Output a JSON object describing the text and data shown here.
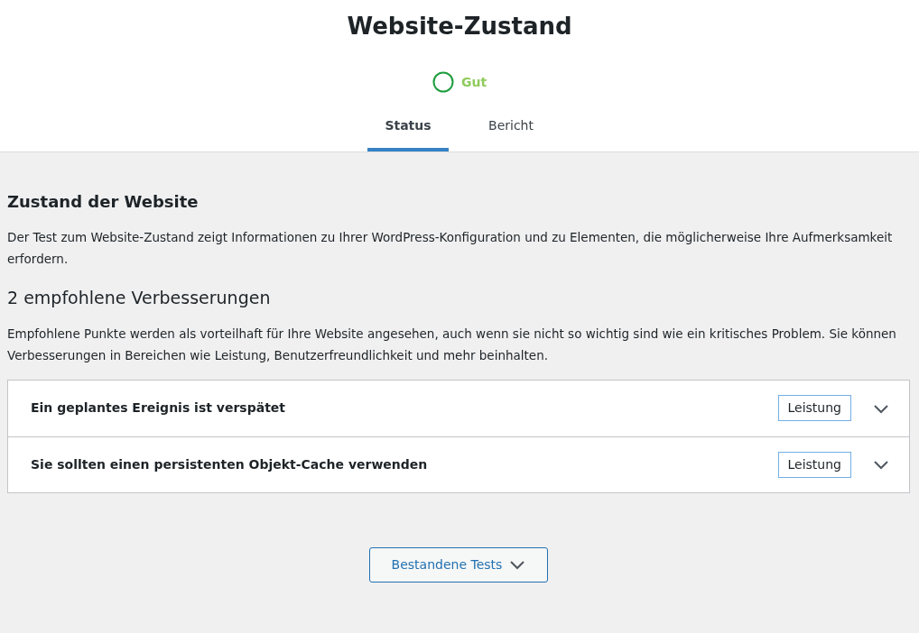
{
  "title": "Website-Zustand",
  "status": {
    "label": "Gut"
  },
  "tabs": [
    {
      "label": "Status",
      "selected": true
    },
    {
      "label": "Bericht",
      "selected": false
    }
  ],
  "section": {
    "heading": "Zustand der Website",
    "description": "Der Test zum Website-Zustand zeigt Informationen zu Ihrer WordPress-Konfiguration und zu Elementen, die möglicherweise Ihre Aufmerksamkeit erfordern."
  },
  "recommended": {
    "heading": "2 empfohlene Verbesserungen",
    "description": "Empfohlene Punkte werden als vorteilhaft für Ihre Website angesehen, auch wenn sie nicht so wichtig sind wie ein kritisches Problem. Sie können Verbesserungen in Bereichen wie Leistung, Benutzerfreundlichkeit und mehr beinhalten.",
    "items": [
      {
        "title": "Ein geplantes Ereignis ist verspätet",
        "tag": "Leistung",
        "expanded": false
      },
      {
        "title": "Sie sollten einen persistenten Objekt-Cache verwenden",
        "tag": "Leistung",
        "expanded": false
      }
    ]
  },
  "passed_button": {
    "label": "Bestandene Tests",
    "expanded": false
  }
}
